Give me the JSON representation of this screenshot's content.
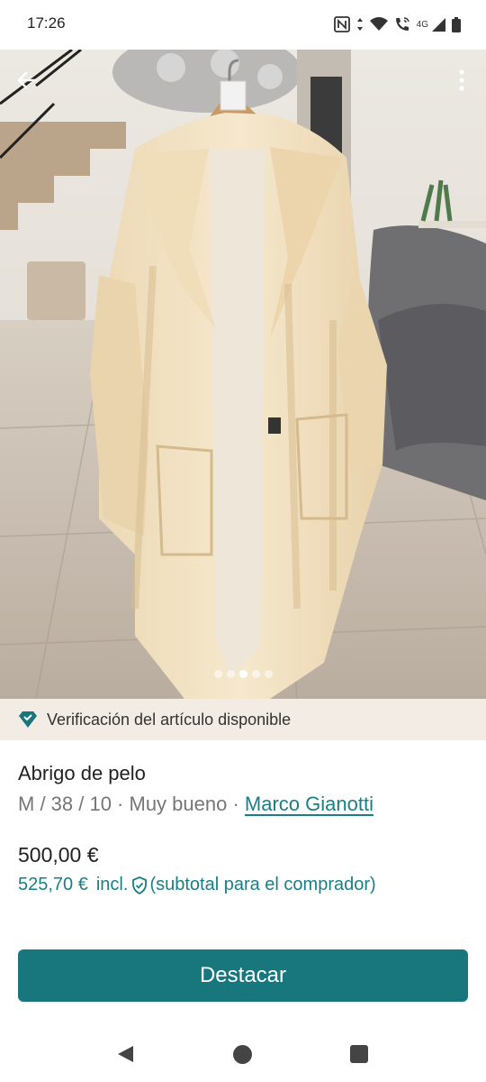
{
  "status_bar": {
    "time": "17:26",
    "network_label": "4G",
    "icons": [
      "nfc-icon",
      "data-arrows-icon",
      "wifi-icon",
      "wifi-call-icon",
      "signal-icon",
      "battery-icon"
    ]
  },
  "photo": {
    "page_count": 5,
    "active_page": 3,
    "icons": [
      "back-arrow-icon",
      "more-vert-icon"
    ]
  },
  "verification": {
    "text": "Verificación del artículo disponible",
    "icon": "diamond-icon",
    "color": "#17777d"
  },
  "item": {
    "title": "Abrigo de pelo",
    "details_prefix": "M / 38 / 10 · Muy bueno · ",
    "brand": "Marco Gianotti",
    "price": "500,00 €",
    "buyer_price": "525,70 €",
    "buyer_incl": "incl.",
    "buyer_note": "(subtotal para el comprador)"
  },
  "actions": {
    "promote_label": "Destacar",
    "accent_color": "#17777d"
  },
  "nav": {
    "icons": [
      "nav-back-icon",
      "nav-home-icon",
      "nav-recents-icon"
    ]
  }
}
